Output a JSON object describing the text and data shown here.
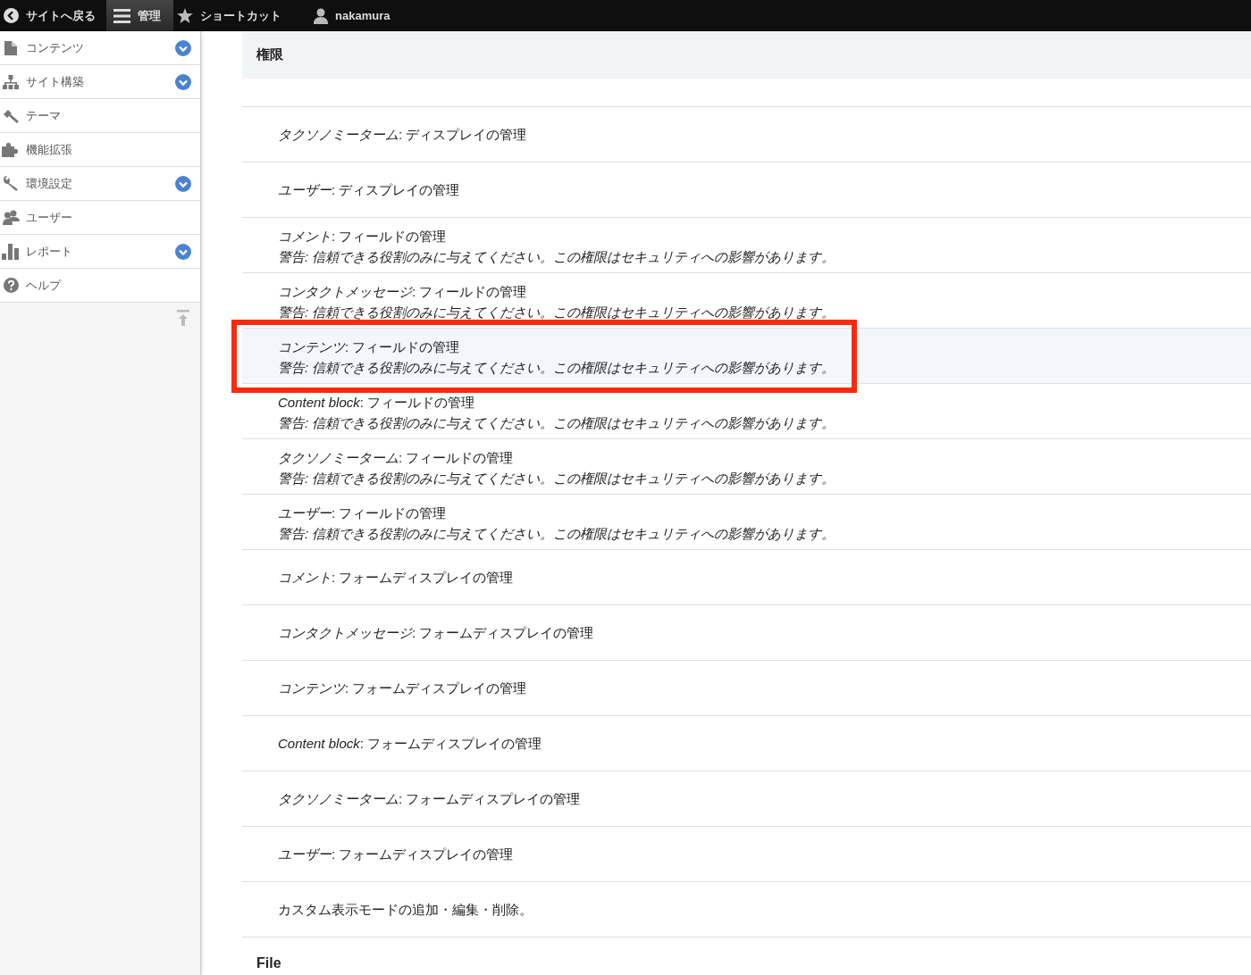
{
  "toolbar": {
    "items": [
      {
        "label": "サイトへ戻る",
        "kind": "back",
        "selected": false
      },
      {
        "label": "管理",
        "kind": "menu",
        "selected": true
      },
      {
        "label": "ショートカット",
        "kind": "star",
        "selected": false
      },
      {
        "label": "nakamura",
        "kind": "user",
        "selected": false
      }
    ]
  },
  "sidebar": {
    "items": [
      {
        "label": "コンテンツ",
        "kind": "document",
        "expandable": true
      },
      {
        "label": "サイト構築",
        "kind": "sitemap",
        "expandable": true
      },
      {
        "label": "テーマ",
        "kind": "brush",
        "expandable": false
      },
      {
        "label": "機能拡張",
        "kind": "puzzle",
        "expandable": false
      },
      {
        "label": "環境設定",
        "kind": "wrench",
        "expandable": true
      },
      {
        "label": "ユーザー",
        "kind": "people",
        "expandable": false
      },
      {
        "label": "レポート",
        "kind": "chart",
        "expandable": true
      },
      {
        "label": "ヘルプ",
        "kind": "help",
        "expandable": false
      }
    ]
  },
  "section": {
    "title": "権限",
    "rows": [
      {
        "title": "*タクソノミーターム*: ディスプレイの管理",
        "highlighted": false,
        "annotated": false
      },
      {
        "title": "*ユーザー*: ディスプレイの管理",
        "highlighted": false,
        "annotated": false
      },
      {
        "title": "*コメント*: フィールドの管理",
        "warning": "警告: 信頼できる役割のみに与えてください。この権限はセキュリティへの影響があります。",
        "highlighted": false,
        "annotated": false
      },
      {
        "title": "*コンタクトメッセージ*: フィールドの管理",
        "warning": "警告: 信頼できる役割のみに与えてください。この権限はセキュリティへの影響があります。",
        "highlighted": false,
        "annotated": false
      },
      {
        "title": "*コンテンツ*: フィールドの管理",
        "warning": "警告: 信頼できる役割のみに与えてください。この権限はセキュリティへの影響があります。",
        "highlighted": true,
        "annotated": true
      },
      {
        "title": "*Content block*: フィールドの管理",
        "warning": "警告: 信頼できる役割のみに与えてください。この権限はセキュリティへの影響があります。",
        "highlighted": false,
        "annotated": false
      },
      {
        "title": "*タクソノミーターム*: フィールドの管理",
        "warning": "警告: 信頼できる役割のみに与えてください。この権限はセキュリティへの影響があります。",
        "highlighted": false,
        "annotated": false
      },
      {
        "title": "*ユーザー*: フィールドの管理",
        "warning": "警告: 信頼できる役割のみに与えてください。この権限はセキュリティへの影響があります。",
        "highlighted": false,
        "annotated": false
      },
      {
        "title": "*コメント*: フォームディスプレイの管理",
        "highlighted": false,
        "annotated": false
      },
      {
        "title": "*コンタクトメッセージ*: フォームディスプレイの管理",
        "highlighted": false,
        "annotated": false
      },
      {
        "title": "*コンテンツ*: フォームディスプレイの管理",
        "highlighted": false,
        "annotated": false
      },
      {
        "title": "*Content block*: フォームディスプレイの管理",
        "highlighted": false,
        "annotated": false
      },
      {
        "title": "*タクソノミーターム*: フォームディスプレイの管理",
        "highlighted": false,
        "annotated": false
      },
      {
        "title": "*ユーザー*: フォームディスプレイの管理",
        "highlighted": false,
        "annotated": false
      },
      {
        "title": "カスタム表示モードの追加・編集・削除。",
        "highlighted": false,
        "annotated": false
      }
    ]
  },
  "next_section": {
    "title": "File"
  }
}
